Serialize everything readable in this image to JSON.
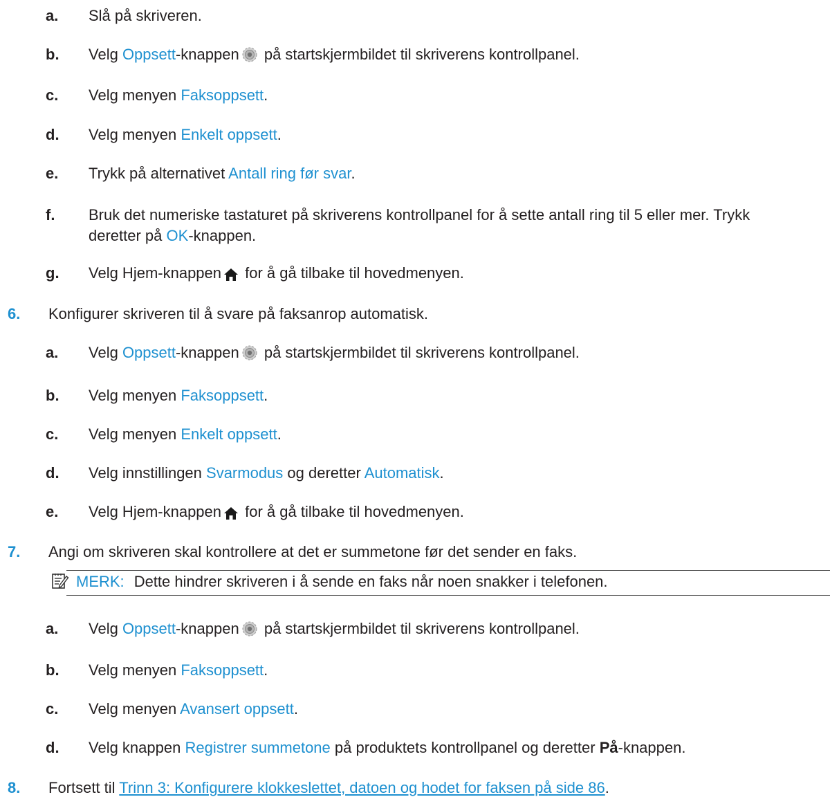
{
  "icons": {
    "gear": "gear-icon",
    "home": "home-icon",
    "note": "note-pencil-icon"
  },
  "colors": {
    "link": "#1e90d0",
    "text": "#231f20"
  },
  "s5": {
    "a": {
      "marker": "a.",
      "text": "Slå på skriveren."
    },
    "b": {
      "marker": "b.",
      "p1": "Velg ",
      "link": "Oppsett",
      "p2": "-knappen",
      "p3": " på startskjermbildet til skriverens kontrollpanel."
    },
    "c": {
      "marker": "c.",
      "p1": "Velg menyen ",
      "link": "Faksoppsett",
      "p2": "."
    },
    "d": {
      "marker": "d.",
      "p1": "Velg menyen ",
      "link": "Enkelt oppsett",
      "p2": "."
    },
    "e": {
      "marker": "e.",
      "p1": "Trykk på alternativet ",
      "link": "Antall ring før svar",
      "p2": "."
    },
    "f": {
      "marker": "f.",
      "p1": "Bruk det numeriske tastaturet på skriverens kontrollpanel for å sette antall ring til 5 eller mer. Trykk",
      "p2": "deretter på ",
      "link": "OK",
      "p3": "-knappen."
    },
    "g": {
      "marker": "g.",
      "p1": "Velg Hjem-knappen",
      "p2": " for å gå tilbake til hovedmenyen."
    }
  },
  "s6": {
    "marker": "6.",
    "text": "Konfigurer skriveren til å svare på faksanrop automatisk.",
    "a": {
      "marker": "a.",
      "p1": "Velg ",
      "link": "Oppsett",
      "p2": "-knappen",
      "p3": " på startskjermbildet til skriverens kontrollpanel."
    },
    "b": {
      "marker": "b.",
      "p1": "Velg menyen ",
      "link": "Faksoppsett",
      "p2": "."
    },
    "c": {
      "marker": "c.",
      "p1": "Velg menyen ",
      "link": "Enkelt oppsett",
      "p2": "."
    },
    "d": {
      "marker": "d.",
      "p1": "Velg innstillingen ",
      "link1": "Svarmodus",
      "p2": " og deretter ",
      "link2": "Automatisk",
      "p3": "."
    },
    "e": {
      "marker": "e.",
      "p1": "Velg Hjem-knappen",
      "p2": " for å gå tilbake til hovedmenyen."
    }
  },
  "s7": {
    "marker": "7.",
    "text": "Angi om skriveren skal kontrollere at det er summetone før det sender en faks.",
    "note": {
      "label": "MERK:",
      "text": "Dette hindrer skriveren i å sende en faks når noen snakker i telefonen."
    },
    "a": {
      "marker": "a.",
      "p1": "Velg ",
      "link": "Oppsett",
      "p2": "-knappen",
      "p3": " på startskjermbildet til skriverens kontrollpanel."
    },
    "b": {
      "marker": "b.",
      "p1": "Velg menyen ",
      "link": "Faksoppsett",
      "p2": "."
    },
    "c": {
      "marker": "c.",
      "p1": "Velg menyen ",
      "link": "Avansert oppsett",
      "p2": "."
    },
    "d": {
      "marker": "d.",
      "p1": "Velg knappen ",
      "link": "Registrer summetone",
      "p2": " på produktets kontrollpanel og deretter ",
      "bold": "På",
      "p3": "-knappen."
    }
  },
  "s8": {
    "marker": "8.",
    "p1": "Fortsett til ",
    "link": "Trinn 3: Konfigurere klokkeslettet, datoen og hodet for faksen på side 86",
    "p2": "."
  }
}
